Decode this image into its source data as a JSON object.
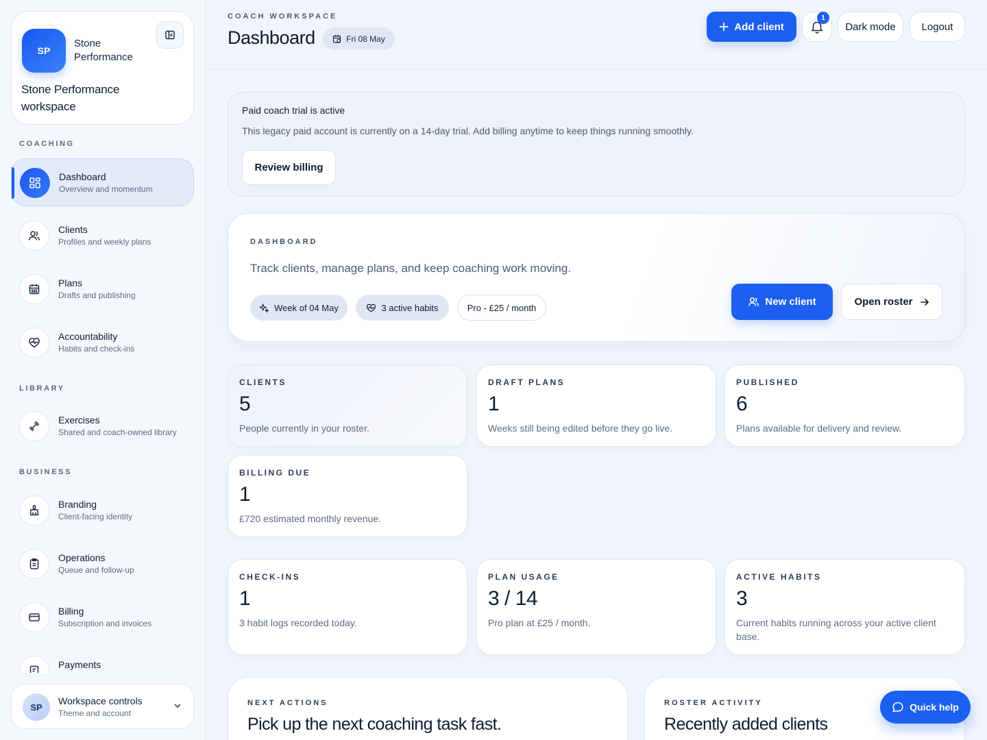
{
  "brand": {
    "logo_initials": "SP",
    "name": "Stone Performance",
    "workspace": "Stone Performance workspace"
  },
  "sidebar": {
    "sections": {
      "coaching": "COACHING",
      "library": "LIBRARY",
      "business": "BUSINESS"
    },
    "items": [
      {
        "title": "Dashboard",
        "subtitle": "Overview and momentum",
        "icon": "grid-icon",
        "active": true
      },
      {
        "title": "Clients",
        "subtitle": "Profiles and weekly plans",
        "icon": "users-icon"
      },
      {
        "title": "Plans",
        "subtitle": "Drafts and publishing",
        "icon": "calendar-icon"
      },
      {
        "title": "Accountability",
        "subtitle": "Habits and check-ins",
        "icon": "heart-pulse-icon"
      },
      {
        "title": "Exercises",
        "subtitle": "Shared and coach-owned library",
        "icon": "dumbbell-icon"
      },
      {
        "title": "Branding",
        "subtitle": "Client-facing identity",
        "icon": "brush-icon"
      },
      {
        "title": "Operations",
        "subtitle": "Queue and follow-up",
        "icon": "clipboard-icon"
      },
      {
        "title": "Billing",
        "subtitle": "Subscription and invoices",
        "icon": "credit-card-icon"
      },
      {
        "title": "Payments",
        "subtitle": "",
        "icon": "receipt-icon"
      }
    ],
    "footer": {
      "initials": "SP",
      "title": "Workspace controls",
      "subtitle": "Theme and account"
    }
  },
  "header": {
    "eyebrow": "COACH WORKSPACE",
    "title": "Dashboard",
    "date": "Fri 08 May",
    "add_client": "Add client",
    "notifications_count": "1",
    "dark_mode": "Dark mode",
    "logout": "Logout"
  },
  "trial": {
    "title": "Paid coach trial is active",
    "text": "This legacy paid account is currently on a 14-day trial. Add billing anytime to keep things running smoothly.",
    "button": "Review billing"
  },
  "hero": {
    "eyebrow": "DASHBOARD",
    "text": "Track clients, manage plans, and keep coaching work moving.",
    "chips": {
      "week": "Week of 04 May",
      "habits": "3 active habits",
      "plan": "Pro - £25 / month"
    },
    "new_client": "New client",
    "open_roster": "Open roster"
  },
  "stats": [
    {
      "label": "CLIENTS",
      "value": "5",
      "desc": "People currently in your roster."
    },
    {
      "label": "DRAFT PLANS",
      "value": "1",
      "desc": "Weeks still being edited before they go live."
    },
    {
      "label": "PUBLISHED",
      "value": "6",
      "desc": "Plans available for delivery and review."
    },
    {
      "label": "BILLING DUE",
      "value": "1",
      "desc": "£720 estimated monthly revenue."
    },
    {
      "label": "CHECK-INS",
      "value": "1",
      "desc": "3 habit logs recorded today."
    },
    {
      "label": "PLAN USAGE",
      "value": "3 / 14",
      "desc": "Pro plan at £25 / month."
    },
    {
      "label": "ACTIVE HABITS",
      "value": "3",
      "desc": "Current habits running across your active client base."
    }
  ],
  "next_actions": {
    "eyebrow": "NEXT ACTIONS",
    "title": "Pick up the next coaching task fast."
  },
  "roster_activity": {
    "eyebrow": "ROSTER ACTIVITY",
    "title": "Recently added clients"
  },
  "quick_help": "Quick help",
  "colors": {
    "accent": "#1d5ff0",
    "background": "#f1f5fb",
    "text": "#0f1b33",
    "muted": "#5d6a82"
  }
}
